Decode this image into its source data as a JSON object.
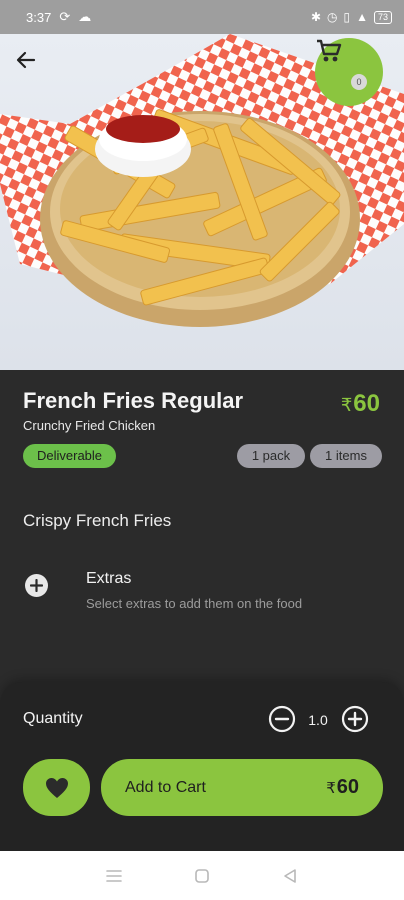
{
  "status_bar": {
    "time": "3:37",
    "battery": "73"
  },
  "product": {
    "name": "French Fries Regular",
    "subtitle": "Crunchy Fried Chicken",
    "currency": "₹",
    "price": "60",
    "badge": "Deliverable",
    "pack": "1 pack",
    "items": "1 items",
    "description": "Crispy French Fries"
  },
  "extras": {
    "title": "Extras",
    "hint": "Select extras to add them on the food"
  },
  "cart": {
    "count": "0"
  },
  "quantity": {
    "label": "Quantity",
    "value": "1.0"
  },
  "actions": {
    "add_to_cart": "Add to Cart",
    "amount": "60"
  },
  "colors": {
    "accent": "#8bc53f",
    "badge": "#6cc04a",
    "surface": "#2b2b2b",
    "sheet": "#232323"
  },
  "icons": [
    "back-arrow-icon",
    "cart-icon",
    "add-circle-icon",
    "minus-circle-icon",
    "plus-circle-icon",
    "heart-icon",
    "menu-icon",
    "home-icon",
    "back-icon"
  ]
}
